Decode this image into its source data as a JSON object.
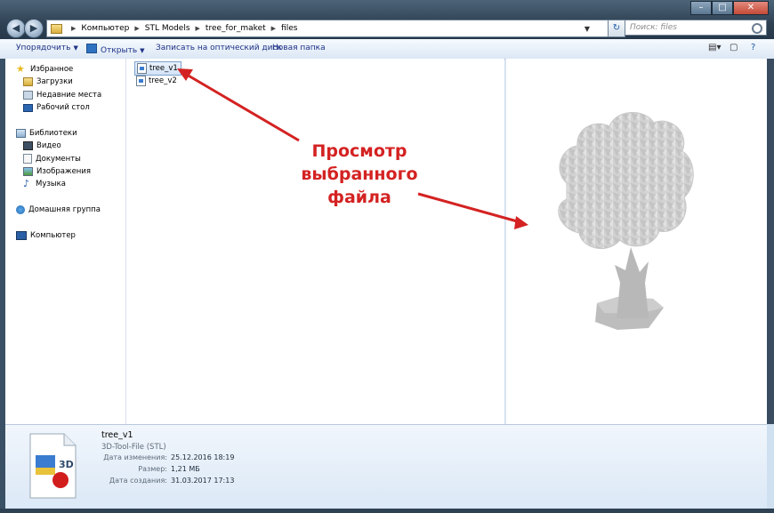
{
  "window": {
    "caption_buttons": [
      "–",
      "□",
      "✕"
    ]
  },
  "nav": {
    "back": "◀",
    "forward": "▶",
    "breadcrumb": [
      "Компьютер",
      "STL Models",
      "tree_for_maket",
      "files"
    ],
    "search_placeholder": "Поиск: files"
  },
  "toolbar": {
    "organize": "Упорядочить",
    "open": "Открыть",
    "burn": "Записать на оптический диск",
    "new_folder": "Новая папка"
  },
  "sidebar": {
    "favorites": "Избранное",
    "favorites_items": [
      "Загрузки",
      "Недавние места",
      "Рабочий стол"
    ],
    "libraries": "Библиотеки",
    "libraries_items": [
      "Видео",
      "Документы",
      "Изображения",
      "Музыка"
    ],
    "homegroup": "Домашняя группа",
    "computer": "Компьютер"
  },
  "files": [
    {
      "name": "tree_v1",
      "selected": true
    },
    {
      "name": "tree_v2",
      "selected": false
    }
  ],
  "annotation": {
    "lines": [
      "Просмотр",
      "выбранного",
      "файла"
    ],
    "color": "#d42222"
  },
  "details": {
    "name": "tree_v1",
    "type": "3D-Tool-File (STL)",
    "modified_label": "Дата изменения:",
    "modified_value": "25.12.2016 18:19",
    "size_label": "Размер:",
    "size_value": "1,21 МБ",
    "created_label": "Дата создания:",
    "created_value": "31.03.2017 17:13",
    "icon_text": "3D"
  }
}
